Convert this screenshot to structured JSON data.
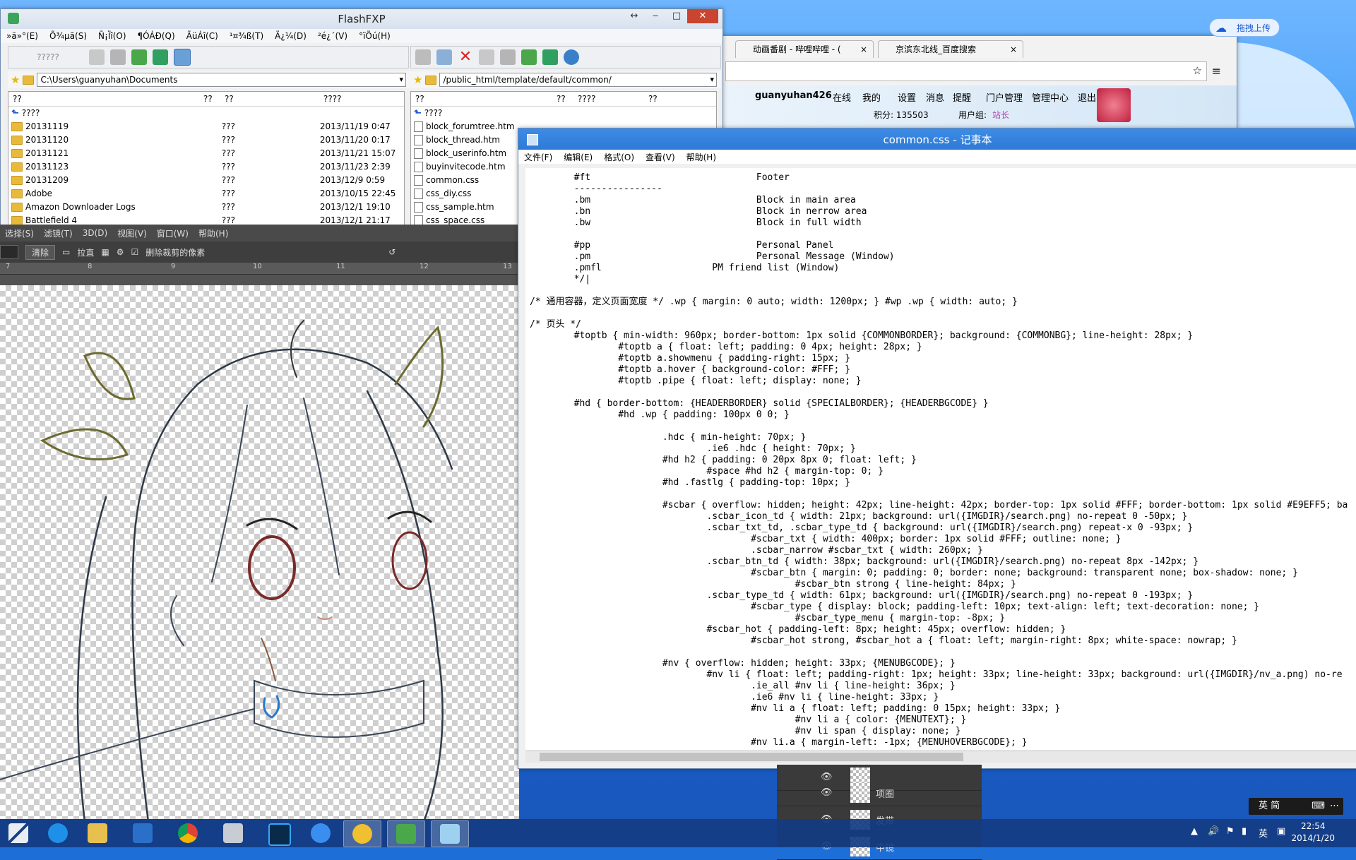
{
  "flashfxp": {
    "title": "FlashFXP",
    "menu": [
      "»ä»°(E)",
      "Õ¾µã(S)",
      "Ñ¡Ïî(O)",
      "¶ÓÁÐ(Q)",
      "ÃüÁî(C)",
      "¹¤¾ß(T)",
      "Ä¿¼(D)",
      "²é¿´(V)",
      "°ïÖú(H)"
    ],
    "left_connect_label": "?????",
    "left_path": "C:\\Users\\guanyuhan\\Documents",
    "right_path": "/public_html/template/default/common/",
    "left_headers": [
      "??",
      "??",
      "??",
      "????"
    ],
    "right_headers": [
      "??",
      "??",
      "????",
      "??"
    ],
    "up_label": "????",
    "left_rows": [
      {
        "name": "20131119",
        "type": "???",
        "date": "2013/11/19 0:47"
      },
      {
        "name": "20131120",
        "type": "???",
        "date": "2013/11/20 0:17"
      },
      {
        "name": "20131121",
        "type": "???",
        "date": "2013/11/21 15:07"
      },
      {
        "name": "20131123",
        "type": "???",
        "date": "2013/11/23 2:39"
      },
      {
        "name": "20131209",
        "type": "???",
        "date": "2013/12/9 0:59"
      },
      {
        "name": "Adobe",
        "type": "???",
        "date": "2013/10/15 22:45"
      },
      {
        "name": "Amazon Downloader Logs",
        "type": "???",
        "date": "2013/12/1 19:10"
      },
      {
        "name": "Battlefield 4",
        "type": "???",
        "date": "2013/12/1 21:17"
      }
    ],
    "right_rows": [
      {
        "name": "block_forumtree.htm"
      },
      {
        "name": "block_thread.htm"
      },
      {
        "name": "block_userinfo.htm"
      },
      {
        "name": "buyinvitecode.htm"
      },
      {
        "name": "common.css"
      },
      {
        "name": "css_diy.css"
      },
      {
        "name": "css_sample.htm"
      },
      {
        "name": "css_space.css"
      }
    ]
  },
  "browser": {
    "tabs": [
      {
        "label": "动画番剧 - 哔哩哔哩 - ("
      },
      {
        "label": "京滨东北线_百度搜索"
      }
    ],
    "user": "guanyuhan426",
    "online": "在线",
    "links": [
      "我的",
      "设置",
      "消息",
      "提醒",
      "门户管理",
      "管理中心",
      "退出"
    ],
    "points": "积分: 135503",
    "group_label": "用户组:",
    "group_value": "站长"
  },
  "upload_label": "拖拽上传",
  "photoshop": {
    "menu": [
      "选择(S)",
      "滤镜(T)",
      "3D(D)",
      "视图(V)",
      "窗口(W)",
      "帮助(H)"
    ],
    "opt_clear": "清除",
    "opt_straighten": "拉直",
    "opt_delete_crop": "删除裁剪的像素",
    "ruler_marks": [
      "7",
      "8",
      "9",
      "10",
      "11",
      "12",
      "13"
    ],
    "layers": [
      "项圈",
      "发带",
      "中镜"
    ]
  },
  "notepad": {
    "title": "common.css - 记事本",
    "menu": [
      "文件(F)",
      "编辑(E)",
      "格式(O)",
      "查看(V)",
      "帮助(H)"
    ],
    "lines": [
      "        #ft                              Footer",
      "        ----------------",
      "        .bm                              Block in main area",
      "        .bn                              Block in nerrow area",
      "        .bw                              Block in full width",
      "",
      "        #pp                              Personal Panel",
      "        .pm                              Personal Message (Window)",
      "        .pmfl                    PM friend list (Window)",
      "        */|",
      "",
      "/* 通用容器，定义页面宽度 */ .wp { margin: 0 auto; width: 1200px; } #wp .wp { width: auto; }",
      "",
      "/* 页头 */",
      "        #toptb { min-width: 960px; border-bottom: 1px solid {COMMONBORDER}; background: {COMMONBG}; line-height: 28px; }",
      "                #toptb a { float: left; padding: 0 4px; height: 28px; }",
      "                #toptb a.showmenu { padding-right: 15px; }",
      "                #toptb a.hover { background-color: #FFF; }",
      "                #toptb .pipe { float: left; display: none; }",
      "",
      "        #hd { border-bottom: {HEADERBORDER} solid {SPECIALBORDER}; {HEADERBGCODE} }",
      "                #hd .wp { padding: 100px 0 0; }",
      "",
      "                        .hdc { min-height: 70px; }",
      "                                .ie6 .hdc { height: 70px; }",
      "                        #hd h2 { padding: 0 20px 8px 0; float: left; }",
      "                                #space #hd h2 { margin-top: 0; }",
      "                        #hd .fastlg { padding-top: 10px; }",
      "",
      "                        #scbar { overflow: hidden; height: 42px; line-height: 42px; border-top: 1px solid #FFF; border-bottom: 1px solid #E9EFF5; ba",
      "                                .scbar_icon_td { width: 21px; background: url({IMGDIR}/search.png) no-repeat 0 -50px; }",
      "                                .scbar_txt_td, .scbar_type_td { background: url({IMGDIR}/search.png) repeat-x 0 -93px; }",
      "                                        #scbar_txt { width: 400px; border: 1px solid #FFF; outline: none; }",
      "                                        .scbar_narrow #scbar_txt { width: 260px; }",
      "                                .scbar_btn_td { width: 38px; background: url({IMGDIR}/search.png) no-repeat 8px -142px; }",
      "                                        #scbar_btn { margin: 0; padding: 0; border: none; background: transparent none; box-shadow: none; }",
      "                                                #scbar_btn strong { line-height: 84px; }",
      "                                .scbar_type_td { width: 61px; background: url({IMGDIR}/search.png) no-repeat 0 -193px; }",
      "                                        #scbar_type { display: block; padding-left: 10px; text-align: left; text-decoration: none; }",
      "                                                #scbar_type_menu { margin-top: -8px; }",
      "                                #scbar_hot { padding-left: 8px; height: 45px; overflow: hidden; }",
      "                                        #scbar_hot strong, #scbar_hot a { float: left; margin-right: 8px; white-space: nowrap; }",
      "",
      "                        #nv { overflow: hidden; height: 33px; {MENUBGCODE}; }",
      "                                #nv li { float: left; padding-right: 1px; height: 33px; line-height: 33px; background: url({IMGDIR}/nv_a.png) no-re",
      "                                        .ie_all #nv li { line-height: 36px; }",
      "                                        .ie6 #nv li { line-height: 33px; }",
      "                                        #nv li a { float: left; padding: 0 15px; height: 33px; }",
      "                                                #nv li a { color: {MENUTEXT}; }",
      "                                                #nv li span { display: none; }",
      "                                        #nv li.a { margin-left: -1px; {MENUHOVERBGCODE}; }"
    ]
  },
  "ime": {
    "label": "英 简"
  },
  "taskbar": {
    "apps": [
      "start",
      "ie",
      "explorer",
      "flashfxp-blue",
      "chrome",
      "calculator",
      "photoshop",
      "baidu-cloud",
      "qq-browser",
      "flashfxp",
      "notepad"
    ],
    "time": "22:54",
    "date": "2014/1/20",
    "tray_ime": "英"
  },
  "colors": {
    "accent": "#2e7ad6",
    "close": "#c9452f",
    "desktop": "#1e6ed8"
  }
}
